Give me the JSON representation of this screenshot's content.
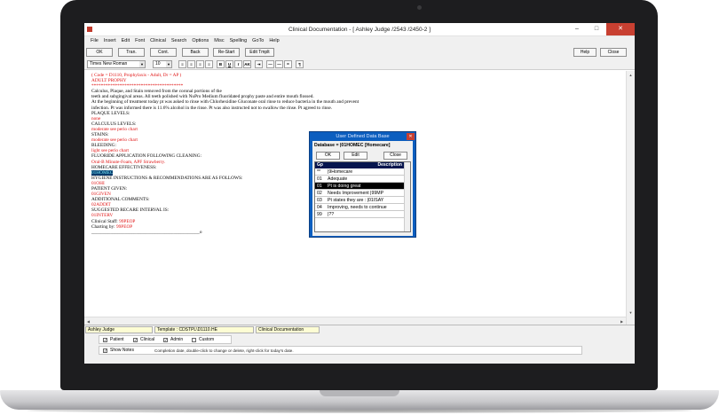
{
  "window": {
    "title": "Clinical Documentation - [ Ashley Judge /2543 /2450-2 ]",
    "minimize": "–",
    "maximize": "□",
    "close": "✕"
  },
  "menu": [
    "File",
    "Insert",
    "Edit",
    "Font",
    "Clinical",
    "Search",
    "Options",
    "Misc",
    "Spelling",
    "GoTo",
    "Help"
  ],
  "toolbar": {
    "ok": "OK",
    "tran": "Tran.",
    "cont": "Cont.",
    "back": "Back",
    "restart": "Re-Start",
    "edit_tmplt": "Edit Tmplt",
    "help": "Help",
    "close": "Close"
  },
  "format_bar": {
    "font": "Times New Roman",
    "size": "10",
    "bold": "B",
    "underline": "U",
    "italic": "I",
    "abc": "AK"
  },
  "document_lines": [
    {
      "text": "( Code = D1110, Prophylaxis - Adult, Dr = AP )",
      "color": "red"
    },
    {
      "text": "ADULT PROPHY",
      "color": "red"
    },
    {
      "text": "***************************************",
      "color": "red"
    },
    {
      "text": "Calculus, Plaque, and Stain removed from the coronal portions of the",
      "color": "black"
    },
    {
      "text": "teeth and subgingival areas. All teeth polished with NuPro Medium fluoridated prophy paste and entire mouth flossed.",
      "color": "black"
    },
    {
      "text": "At the beginning of treatment today pt was asked to rinse with Chlorhexidine Gluconate oral rinse to reduce bacteria in the mouth and prevent",
      "color": "black"
    },
    {
      "text": "infection. Pt was informed there is 11.6% alcohol in the rinse. Pt was also instructed not to swallow the rinse. Pt agreed to rinse.",
      "color": "black"
    },
    {
      "text": "PLAQUE LEVELS:",
      "color": "black"
    },
    {
      "text": "none",
      "color": "red"
    },
    {
      "text": "CALCULUS LEVELS:",
      "color": "black"
    },
    {
      "text": "moderate see perio chart",
      "color": "red"
    },
    {
      "text": "STAINS:",
      "color": "black"
    },
    {
      "text": "moderate see perio chart",
      "color": "red"
    },
    {
      "text": "BLEEDING:",
      "color": "black"
    },
    {
      "text": "light see perio chart",
      "color": "red"
    },
    {
      "text": "FLUORIDE APPLICATION FOLLOWING CLEANING:",
      "color": "black"
    },
    {
      "text": "Oral-B Minute-Foam, APF Strawberry.",
      "color": "red"
    },
    {
      "text": "HOMECARE EFFECTIVENESS:",
      "color": "black"
    },
    {
      "text": "01HOMEC",
      "color": "highlight"
    },
    {
      "text": "HYGIENE INSTRUCTIONS & RECOMMENDATIONS ARE AS FOLLOWS:",
      "color": "black"
    },
    {
      "text": "01OHI",
      "color": "red"
    },
    {
      "text": "PATIENT GIVEN:",
      "color": "black"
    },
    {
      "text": "01GIVEN",
      "color": "red"
    },
    {
      "text": "ADDITIONAL COMMENTS:",
      "color": "black"
    },
    {
      "text": "02ADDIT",
      "color": "red"
    },
    {
      "text": "SUGGESTED RECARE INTERVAL IS:",
      "color": "black"
    },
    {
      "text": "01INTERV",
      "color": "red"
    },
    {
      "text": "Clinical Staff:  99PEOP",
      "color": "mixed"
    },
    {
      "text": "Charting by:  99PEOP",
      "color": "mixed"
    },
    {
      "text": "______________________________________________o",
      "color": "black"
    }
  ],
  "status_bar": {
    "patient": "Ashley Judge",
    "template": "Template : CDSTPL\\D1110.HE",
    "module": "Clinical Documentation"
  },
  "options": {
    "patient": "Patient",
    "clinical": "Clinical",
    "admin": "Admin",
    "custom": "Custom",
    "show_notes": "Show Notes",
    "hint": "Completion date, double-click to change or delete, right-click for today's date."
  },
  "dialog": {
    "title": "User Defined Data Base",
    "database": "Database = |01HOMEC [Homecare]",
    "ok": "OK",
    "edit": "Edit",
    "close": "Close",
    "col_gp": "Gp",
    "col_desc": "Description",
    "rows": [
      {
        "gp": "**",
        "desc": "|9Homecare"
      },
      {
        "gp": "01",
        "desc": "Adequate"
      },
      {
        "gp": "01",
        "desc": "Pt is doing great"
      },
      {
        "gp": "02",
        "desc": "Needs Improvement |99MP"
      },
      {
        "gp": "03",
        "desc": "Pt states they are : |01ISAY"
      },
      {
        "gp": "04",
        "desc": "Improving, needs to continue"
      },
      {
        "gp": "99",
        "desc": "|??"
      }
    ],
    "selected_index": 2
  }
}
